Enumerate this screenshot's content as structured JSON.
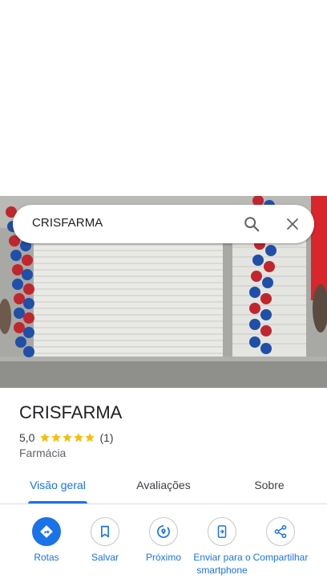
{
  "search": {
    "query": "CRISFARMA"
  },
  "place": {
    "name": "CRISFARMA",
    "rating": "5,0",
    "rating_value": 5.0,
    "review_count": "(1)",
    "category": "Farmácia",
    "star_color": "#fbbc04"
  },
  "tabs": [
    {
      "label": "Visão geral",
      "active": true
    },
    {
      "label": "Avaliações",
      "active": false
    },
    {
      "label": "Sobre",
      "active": false
    }
  ],
  "actions": [
    {
      "label": "Rotas",
      "icon": "directions-icon"
    },
    {
      "label": "Salvar",
      "icon": "bookmark-icon"
    },
    {
      "label": "Próximo",
      "icon": "nearby-icon"
    },
    {
      "label": "Enviar para o smartphone",
      "icon": "send-to-phone-icon"
    },
    {
      "label": "Compartilhar",
      "icon": "share-icon"
    }
  ],
  "colors": {
    "accent": "#1a73e8",
    "text": "#202124",
    "muted": "#5f6368"
  }
}
